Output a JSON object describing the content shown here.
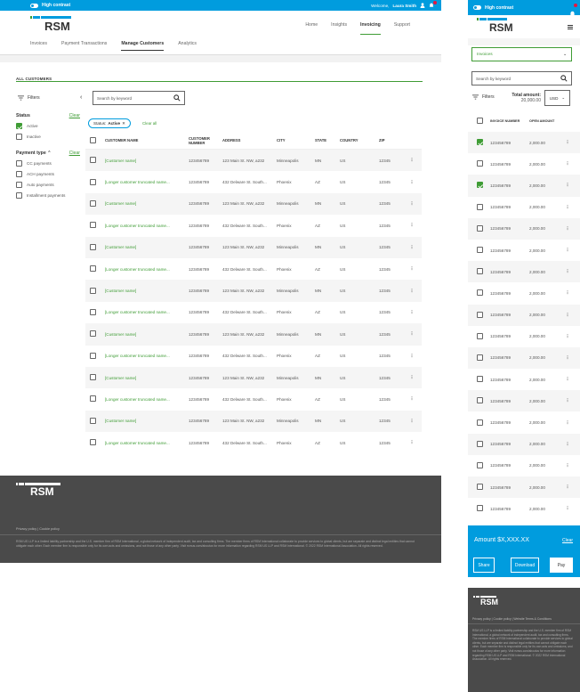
{
  "desktop": {
    "topbar": {
      "high_contrast": "High contrast",
      "welcome_prefix": "Welcome,",
      "user_name": "Laura Smith"
    },
    "logo": "RSM",
    "topnav": [
      "Home",
      "Insights",
      "Invoicing",
      "Support"
    ],
    "subnav": [
      "Invoices",
      "Payment Transactions",
      "Manage Customers",
      "Analytics"
    ],
    "section_title": "ALL CUSTOMERS",
    "filters": {
      "label": "Filters",
      "status": {
        "title": "Status",
        "clear": "Clear",
        "options": [
          {
            "label": "Active",
            "checked": true
          },
          {
            "label": "Inactive",
            "checked": false
          }
        ]
      },
      "payment_type": {
        "title": "Payment type",
        "clear": "Clear",
        "options": [
          {
            "label": "CC payments",
            "checked": false
          },
          {
            "label": "ACH payments",
            "checked": false
          },
          {
            "label": "Auto payments",
            "checked": false
          },
          {
            "label": "Installment payments",
            "checked": false
          }
        ]
      }
    },
    "search": {
      "placeholder": "Search by keyword"
    },
    "chip": {
      "prefix": "Status:",
      "value": "Active"
    },
    "clear_all": "Clear all",
    "table": {
      "headers": {
        "name": "CUSTOMER NAME",
        "number_line1": "CUSTOMER",
        "number_line2": "NUMBER",
        "address": "ADDRESS",
        "city": "CITY",
        "state": "STATE",
        "country": "COUNTRY",
        "zip": "ZIP"
      },
      "rows": [
        {
          "name": "[Customer name]",
          "number": "123456789",
          "address": "123 Main St. NW, a232",
          "city": "Minneapolis",
          "state": "MN",
          "country": "US",
          "zip": "12345"
        },
        {
          "name": "[Longer customer truncated name...",
          "number": "123456789",
          "address": "432 Delware St. South...",
          "city": "Phoenix",
          "state": "AZ",
          "country": "US",
          "zip": "12345"
        },
        {
          "name": "[Customer name]",
          "number": "123456789",
          "address": "123 Main St. NW, a232",
          "city": "Minneapolis",
          "state": "MN",
          "country": "US",
          "zip": "12345"
        },
        {
          "name": "[Longer customer truncated name...",
          "number": "123456789",
          "address": "432 Delware St. South...",
          "city": "Phoenix",
          "state": "AZ",
          "country": "US",
          "zip": "12345"
        },
        {
          "name": "[Customer name]",
          "number": "123456789",
          "address": "123 Main St. NW, a232",
          "city": "Minneapolis",
          "state": "MN",
          "country": "US",
          "zip": "12345"
        },
        {
          "name": "[Longer customer truncated name...",
          "number": "123456789",
          "address": "432 Delware St. South...",
          "city": "Phoenix",
          "state": "AZ",
          "country": "US",
          "zip": "12345"
        },
        {
          "name": "[Customer name]",
          "number": "123456789",
          "address": "123 Main St. NW, a232",
          "city": "Minneapolis",
          "state": "MN",
          "country": "US",
          "zip": "12345"
        },
        {
          "name": "[Longer customer truncated name...",
          "number": "123456789",
          "address": "432 Delware St. South...",
          "city": "Phoenix",
          "state": "AZ",
          "country": "US",
          "zip": "12345"
        },
        {
          "name": "[Customer name]",
          "number": "123456789",
          "address": "123 Main St. NW, a232",
          "city": "Minneapolis",
          "state": "MN",
          "country": "US",
          "zip": "12345"
        },
        {
          "name": "[Longer customer truncated name...",
          "number": "123456789",
          "address": "432 Delware St. South...",
          "city": "Phoenix",
          "state": "AZ",
          "country": "US",
          "zip": "12345"
        },
        {
          "name": "[Customer name]",
          "number": "123456789",
          "address": "123 Main St. NW, a232",
          "city": "Minneapolis",
          "state": "MN",
          "country": "US",
          "zip": "12345"
        },
        {
          "name": "[Longer customer truncated name...",
          "number": "123456789",
          "address": "432 Delware St. South...",
          "city": "Phoenix",
          "state": "AZ",
          "country": "US",
          "zip": "12345"
        },
        {
          "name": "[Customer name]",
          "number": "123456789",
          "address": "123 Main St. NW, a232",
          "city": "Minneapolis",
          "state": "MN",
          "country": "US",
          "zip": "12345"
        },
        {
          "name": "[Longer customer truncated name...",
          "number": "123456789",
          "address": "432 Delware St. South...",
          "city": "Phoenix",
          "state": "AZ",
          "country": "US",
          "zip": "12345"
        }
      ]
    },
    "footer": {
      "logo": "RSM",
      "links": "Privacy policy  |  Cookie policy",
      "legal": "RSM US LLP is a limited liability partnership and the U.S. member firm of RSM International, a global network of independent audit, tax and consulting firms. The member firms of RSM International collaborate to provide services to global clients, but are separate and distinct legal entities that cannot obligate each other. Each member firm is responsible only for its own acts and omissions, and not those of any other party. Visit rsmus.com/aboutus for more information regarding RSM US LLP and RSM International. © 2022 RSM International Association. All rights reserved."
    }
  },
  "mobile": {
    "topbar": {
      "high_contrast": "High contrast"
    },
    "logo": "RSM",
    "select": {
      "value": "Invoices"
    },
    "search": {
      "placeholder": "Search by keyword"
    },
    "filters_label": "Filters",
    "total": {
      "label": "Total amount:",
      "value": "20,000.00"
    },
    "currency": "USD",
    "table": {
      "headers": {
        "invoice": "INVOICE NUMBER",
        "amount": "OPEN AMOUNT"
      },
      "rows": [
        {
          "invoice": "123456789",
          "amount": "2,000.00",
          "checked": true
        },
        {
          "invoice": "123456789",
          "amount": "2,000.00",
          "checked": false
        },
        {
          "invoice": "123456789",
          "amount": "2,000.00",
          "checked": true
        },
        {
          "invoice": "123456789",
          "amount": "2,000.00",
          "checked": false
        },
        {
          "invoice": "123456789",
          "amount": "2,000.00",
          "checked": false
        },
        {
          "invoice": "123456789",
          "amount": "2,000.00",
          "checked": false
        },
        {
          "invoice": "123456789",
          "amount": "2,000.00",
          "checked": false
        },
        {
          "invoice": "123456789",
          "amount": "2,000.00",
          "checked": false
        },
        {
          "invoice": "123456789",
          "amount": "2,000.00",
          "checked": false
        },
        {
          "invoice": "123456789",
          "amount": "2,000.00",
          "checked": false
        },
        {
          "invoice": "123456789",
          "amount": "2,000.00",
          "checked": false
        },
        {
          "invoice": "123456789",
          "amount": "2,000.00",
          "checked": false
        },
        {
          "invoice": "123456789",
          "amount": "2,000.00",
          "checked": false
        },
        {
          "invoice": "123456789",
          "amount": "2,000.00",
          "checked": false
        },
        {
          "invoice": "123456789",
          "amount": "2,000.00",
          "checked": false
        },
        {
          "invoice": "123456789",
          "amount": "2,000.00",
          "checked": false
        },
        {
          "invoice": "123456789",
          "amount": "2,000.00",
          "checked": false
        },
        {
          "invoice": "123456789",
          "amount": "2,000.00",
          "checked": false
        }
      ]
    },
    "amount_bar": {
      "label": "Amount",
      "value": "$X,XXX.XX",
      "clear": "Clear",
      "share": "Share",
      "download": "Download",
      "pay": "Pay"
    },
    "footer": {
      "logo": "RSM",
      "links": "Privacy policy  |  Cookie policy  |  Website Terms & Conditions",
      "legal": "RSM US LLP is a limited liability partnership and the U.S. member firm of RSM International, a global network of independent audit, tax and consulting firms. The member firms of RSM International collaborate to provide services to global clients, but are separate and distinct legal entities that cannot obligate each other. Each member firm is responsible only for its own acts and omissions, and not those of any other party. Visit rsmus.com/aboutus for more information regarding RSM US LLP and RSM International. © 2022 RSM International Association. All rights reserved."
    }
  },
  "colors": {
    "brand_blue": "#009cde",
    "brand_green": "#3f9c35",
    "footer_gray": "#4a4a4a",
    "alert_red": "#e5173f"
  }
}
